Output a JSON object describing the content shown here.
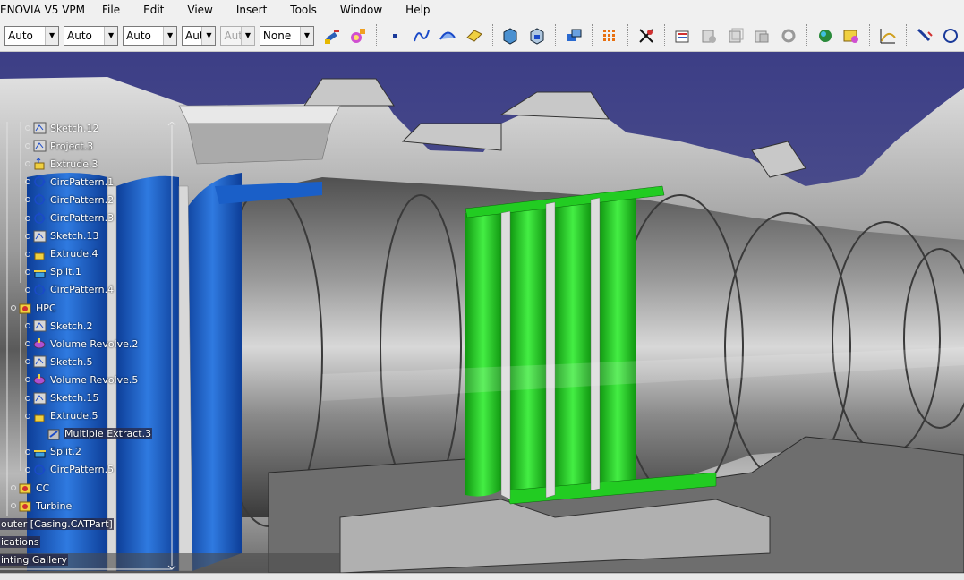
{
  "app": {
    "title": "ENOVIA V5 VPM"
  },
  "menu": [
    "File",
    "Edit",
    "View",
    "Insert",
    "Tools",
    "Window",
    "Help"
  ],
  "toolbar": {
    "selects": [
      {
        "value": "Auto",
        "disabled": false
      },
      {
        "value": "Auto",
        "disabled": false
      },
      {
        "value": "Auto",
        "disabled": false
      },
      {
        "value": "Aut",
        "disabled": false
      },
      {
        "value": "Aut",
        "disabled": true
      },
      {
        "value": "None",
        "disabled": false
      }
    ],
    "icons": [
      "painter-icon",
      "properties-icon",
      "point-icon",
      "spline-icon",
      "curve-icon",
      "surface-icon",
      "part-design-icon",
      "part-body-icon",
      "assembly-icon",
      "grid-icon",
      "snap-icon",
      "catalog-icon",
      "knowledge-icon",
      "copy-icon",
      "paste-icon",
      "rotate-icon",
      "network-icon",
      "render-icon",
      "plot-icon",
      "measure-icon"
    ]
  },
  "tree": {
    "items": [
      {
        "label": "Sketch.12",
        "icon": "sketch-icon",
        "indent": 1
      },
      {
        "label": "Project.3",
        "icon": "sketch-icon",
        "indent": 1
      },
      {
        "label": "Extrude.3",
        "icon": "extrude-icon",
        "indent": 1
      },
      {
        "label": "CircPattern.1",
        "icon": "pattern-icon",
        "indent": 1
      },
      {
        "label": "CircPattern.2",
        "icon": "pattern-icon",
        "indent": 1
      },
      {
        "label": "CircPattern.3",
        "icon": "pattern-icon",
        "indent": 1
      },
      {
        "label": "Sketch.13",
        "icon": "sketch-icon",
        "indent": 1
      },
      {
        "label": "Extrude.4",
        "icon": "extrude-icon",
        "indent": 1
      },
      {
        "label": "Split.1",
        "icon": "split-icon",
        "indent": 1
      },
      {
        "label": "CircPattern.4",
        "icon": "pattern-icon",
        "indent": 1
      },
      {
        "label": "HPC",
        "icon": "geometric-set-icon",
        "indent": 0
      },
      {
        "label": "Sketch.2",
        "icon": "sketch-icon",
        "indent": 1
      },
      {
        "label": "Volume Revolve.2",
        "icon": "revolve-icon",
        "indent": 1
      },
      {
        "label": "Sketch.5",
        "icon": "sketch-icon",
        "indent": 1
      },
      {
        "label": "Volume Revolve.5",
        "icon": "revolve-icon",
        "indent": 1
      },
      {
        "label": "Sketch.15",
        "icon": "sketch-icon",
        "indent": 1
      },
      {
        "label": "Extrude.5",
        "icon": "extrude-icon",
        "indent": 1
      },
      {
        "label": "Multiple Extract.3",
        "icon": "extract-icon",
        "indent": 2
      },
      {
        "label": "Split.2",
        "icon": "split-icon",
        "indent": 1
      },
      {
        "label": "CircPattern.5",
        "icon": "pattern-icon",
        "indent": 1
      },
      {
        "label": "CC",
        "icon": "geometric-set-icon",
        "indent": 0
      },
      {
        "label": "Turbine",
        "icon": "geometric-set-icon",
        "indent": 0
      },
      {
        "label": "outer [Casing.CATPart]",
        "icon": "",
        "indent": -1
      },
      {
        "label": "ications",
        "icon": "",
        "indent": -1
      },
      {
        "label": "inting Gallery",
        "icon": "",
        "indent": -1
      }
    ]
  },
  "colors": {
    "fan_blue": "#1a5fc8",
    "compressor_green": "#22cc22",
    "casing_gray": "#9a9a9a",
    "viewport_bg_top": "#3c3e86",
    "viewport_bg_bottom": "#7d7ea3"
  }
}
